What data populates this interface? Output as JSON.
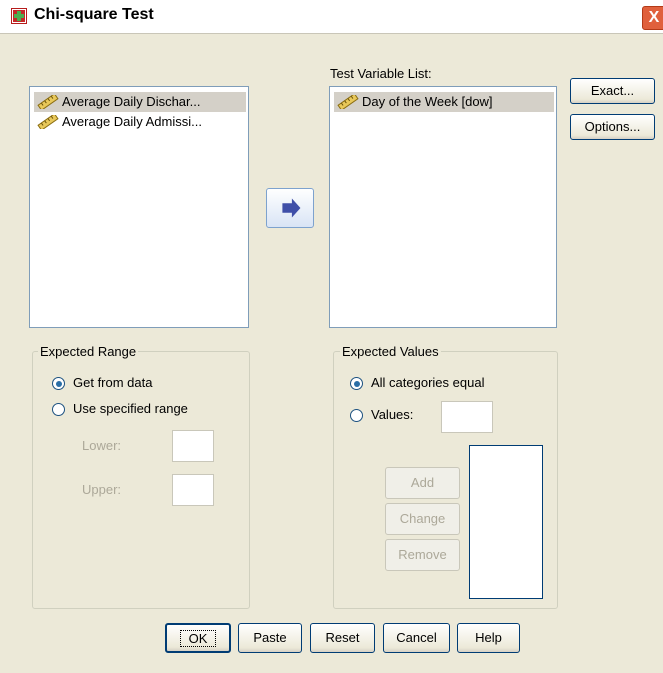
{
  "window": {
    "title": "Chi-square Test",
    "close_glyph": "X"
  },
  "source_list": {
    "items": [
      {
        "label": "Average Daily Dischar...",
        "icon": "ruler-icon",
        "selected": true
      },
      {
        "label": "Average Daily Admissi...",
        "icon": "ruler-icon",
        "selected": false
      }
    ]
  },
  "test_list": {
    "label": "Test Variable List:",
    "items": [
      {
        "label": "Day of the Week [dow]",
        "icon": "ruler-icon",
        "selected": true
      }
    ]
  },
  "side_buttons": {
    "exact": "Exact...",
    "options": "Options..."
  },
  "expected_range": {
    "title": "Expected Range",
    "get_from_data": "Get from data",
    "use_specified": "Use specified range",
    "lower": "Lower:",
    "upper": "Upper:",
    "selected": "get_from_data"
  },
  "expected_values": {
    "title": "Expected Values",
    "all_equal": "All categories equal",
    "values": "Values:",
    "selected": "all_equal",
    "add": "Add",
    "change": "Change",
    "remove": "Remove"
  },
  "bottom_buttons": {
    "ok": "OK",
    "paste": "Paste",
    "reset": "Reset",
    "cancel": "Cancel",
    "help": "Help"
  },
  "colors": {
    "dialog_bg": "#ece9d8",
    "accent_blue": "#2a6ea6",
    "close_red": "#e0603c"
  }
}
